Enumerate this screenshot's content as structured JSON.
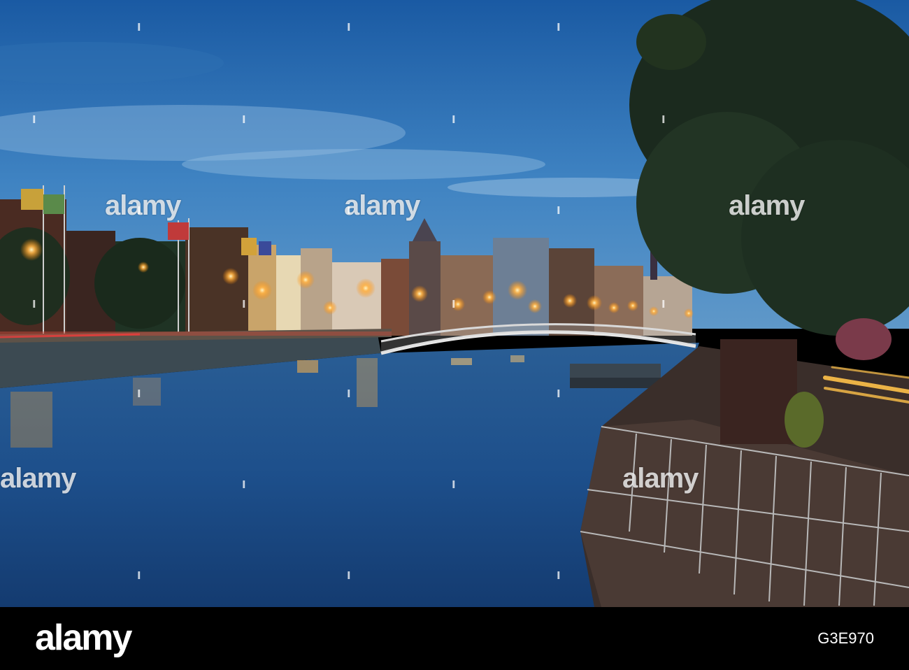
{
  "photo": {
    "scene": "Dusk view of a city river with a lit pedestrian footbridge, illuminated buildings and flags on the left bank, trees and a boardwalk on the right bank",
    "colors": {
      "sky_top": "#1d5fa6",
      "sky_bottom": "#5b95c8",
      "water": "#1a4f8c",
      "water_dark": "#0e2f5e",
      "lights": "#ffb347",
      "trees": "#1c2a1c"
    }
  },
  "watermark": {
    "text": "alamy"
  },
  "footer": {
    "logo": "alamy",
    "image_id": "G3E970"
  }
}
